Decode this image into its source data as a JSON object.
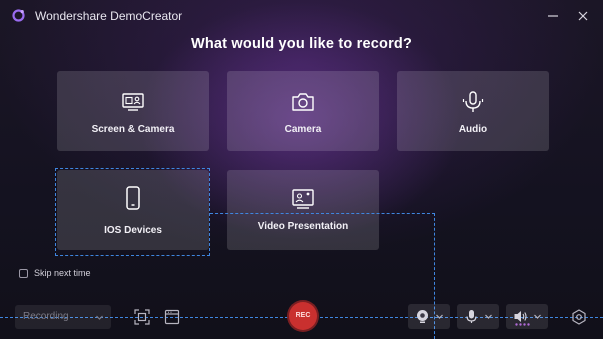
{
  "titlebar": {
    "app_title": "Wondershare DemoCreator",
    "icons": {
      "logo": "democreator-logo",
      "minimize": "minimize-icon",
      "close": "close-icon"
    }
  },
  "main": {
    "heading": "What would you like to record?",
    "options": [
      {
        "label": "Screen & Camera",
        "icon": "screen-camera-icon"
      },
      {
        "label": "Camera",
        "icon": "camera-icon"
      },
      {
        "label": "Audio",
        "icon": "microphone-icon"
      },
      {
        "label": "IOS Devices",
        "icon": "mobile-device-icon",
        "selected": true
      },
      {
        "label": "Video Presentation",
        "icon": "presentation-icon"
      }
    ],
    "skip_next_time": {
      "label": "Skip next time",
      "checked": false
    }
  },
  "toolbar": {
    "mode_select": {
      "value": "Recording"
    },
    "rec_label": "REC",
    "icons": [
      "crop-region-icon",
      "window-icon",
      "webcam-icon",
      "microphone-icon",
      "speaker-icon",
      "settings-icon"
    ]
  },
  "colors": {
    "accent_blue": "#3f86e0",
    "rec_red": "#c9302f",
    "card_bg": "#3a3546",
    "background": "#16131f"
  }
}
